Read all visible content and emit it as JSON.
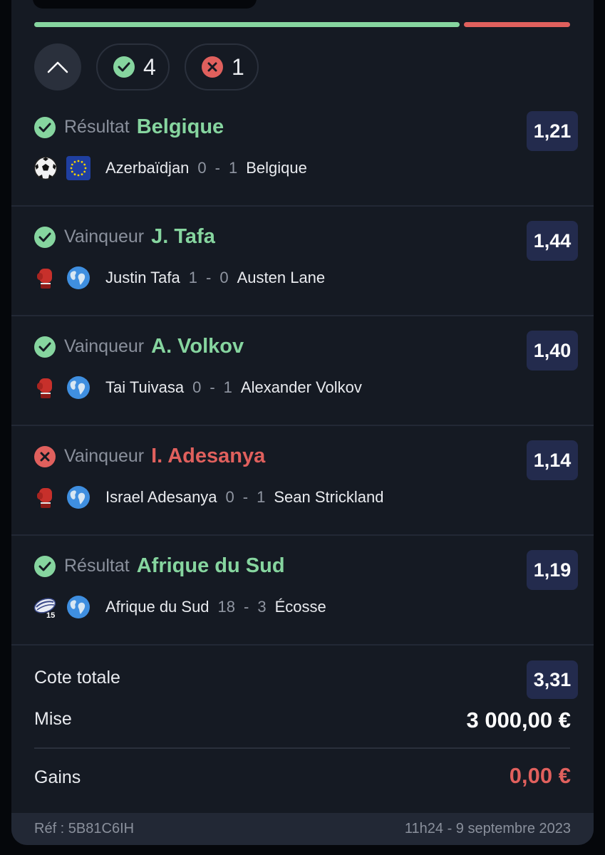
{
  "summary_chips": {
    "won_count": "4",
    "lost_count": "1"
  },
  "progress": {
    "won_fraction": 0.8,
    "lost_fraction": 0.2
  },
  "selections": [
    {
      "status": "won",
      "pick_type": "Résultat",
      "pick": "Belgique",
      "odds": "1,21",
      "sport_icon": "soccer-ball-icon",
      "competition_icon": "eu-flag-icon",
      "home": "Azerbaïdjan",
      "home_score": "0",
      "separator": "-",
      "away_score": "1",
      "away": "Belgique"
    },
    {
      "status": "won",
      "pick_type": "Vainqueur",
      "pick": "J. Tafa",
      "odds": "1,44",
      "sport_icon": "boxing-glove-icon",
      "competition_icon": "globe-icon",
      "home": "Justin Tafa",
      "home_score": "1",
      "separator": "-",
      "away_score": "0",
      "away": "Austen Lane"
    },
    {
      "status": "won",
      "pick_type": "Vainqueur",
      "pick": "A. Volkov",
      "odds": "1,40",
      "sport_icon": "boxing-glove-icon",
      "competition_icon": "globe-icon",
      "home": "Tai Tuivasa",
      "home_score": "0",
      "separator": "-",
      "away_score": "1",
      "away": "Alexander Volkov"
    },
    {
      "status": "lost",
      "pick_type": "Vainqueur",
      "pick": "I. Adesanya",
      "odds": "1,14",
      "sport_icon": "boxing-glove-icon",
      "competition_icon": "globe-icon",
      "home": "Israel Adesanya",
      "home_score": "0",
      "separator": "-",
      "away_score": "1",
      "away": "Sean Strickland"
    },
    {
      "status": "won",
      "pick_type": "Résultat",
      "pick": "Afrique du Sud",
      "odds": "1,19",
      "sport_icon": "rugby-15-icon",
      "competition_icon": "globe-icon",
      "home": "Afrique du Sud",
      "home_score": "18",
      "separator": "-",
      "away_score": "3",
      "away": "Écosse"
    }
  ],
  "totals": {
    "total_odds_label": "Cote totale",
    "total_odds": "3,31",
    "stake_label": "Mise",
    "stake": "3 000,00 €",
    "winnings_label": "Gains",
    "winnings": "0,00 €"
  },
  "footer": {
    "reference": "Réf : 5B81C6IH",
    "datetime": "11h24 - 9 septembre 2023"
  },
  "colors": {
    "win": "#86d59f",
    "loss": "#e0605d",
    "odds_box": "#232b4d",
    "card_bg": "#151a23"
  }
}
